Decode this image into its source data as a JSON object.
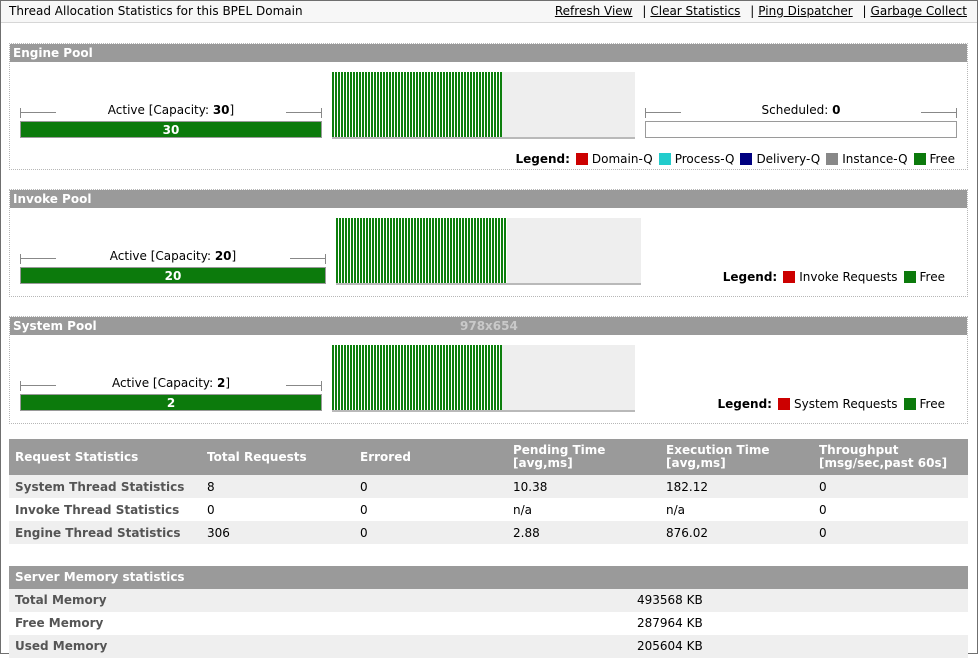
{
  "header": {
    "title": "Thread Allocation Statistics for this BPEL Domain",
    "links": [
      "Refresh View",
      "Clear Statistics",
      "Ping Dispatcher",
      "Garbage Collect"
    ],
    "separator": "|"
  },
  "engine_pool": {
    "title": "Engine Pool",
    "active_prefix": "Active [Capacity: ",
    "capacity": "30",
    "active_suffix": "]",
    "active_value": "30",
    "active_fraction": 1.0,
    "thread_fill_fraction": 0.56,
    "scheduled_label": "Scheduled: ",
    "scheduled_value": "0",
    "legend_title": "Legend:",
    "legend": [
      {
        "label": "Domain-Q",
        "color": "#cc0000"
      },
      {
        "label": "Process-Q",
        "color": "#22cccc"
      },
      {
        "label": "Delivery-Q",
        "color": "#000080"
      },
      {
        "label": "Instance-Q",
        "color": "#888888"
      },
      {
        "label": "Free",
        "color": "#0c7a0c"
      }
    ]
  },
  "invoke_pool": {
    "title": "Invoke Pool",
    "active_prefix": "Active [Capacity: ",
    "capacity": "20",
    "active_suffix": "]",
    "active_value": "20",
    "active_fraction": 1.0,
    "thread_fill_fraction": 0.56,
    "legend_title": "Legend:",
    "legend": [
      {
        "label": "Invoke Requests",
        "color": "#cc0000"
      },
      {
        "label": "Free",
        "color": "#0c7a0c"
      }
    ]
  },
  "system_pool": {
    "title": "System Pool",
    "active_prefix": "Active [Capacity: ",
    "capacity": "2",
    "active_suffix": "]",
    "active_value": "2",
    "active_fraction": 1.0,
    "thread_fill_fraction": 0.56,
    "legend_title": "Legend:",
    "legend": [
      {
        "label": "System Requests",
        "color": "#cc0000"
      },
      {
        "label": "Free",
        "color": "#0c7a0c"
      }
    ]
  },
  "watermark": "978x654",
  "request_stats": {
    "headers": [
      "Request Statistics",
      "Total Requests",
      "Errored",
      "Pending Time",
      "Execution Time",
      "Throughput"
    ],
    "subheaders": [
      "",
      "",
      "",
      "[avg,ms]",
      "[avg,ms]",
      "[msg/sec,past 60s]"
    ],
    "rows": [
      [
        "System Thread Statistics",
        "8",
        "0",
        "10.38",
        "182.12",
        "0"
      ],
      [
        "Invoke Thread Statistics",
        "0",
        "0",
        "n/a",
        "n/a",
        "0"
      ],
      [
        "Engine Thread Statistics",
        "306",
        "0",
        "2.88",
        "876.02",
        "0"
      ]
    ]
  },
  "memory_stats": {
    "title": "Server Memory statistics",
    "rows": [
      {
        "label": "Total Memory",
        "value": "493568 KB"
      },
      {
        "label": "Free Memory",
        "value": "287964 KB"
      },
      {
        "label": "Used Memory",
        "value": "205604 KB"
      }
    ]
  }
}
